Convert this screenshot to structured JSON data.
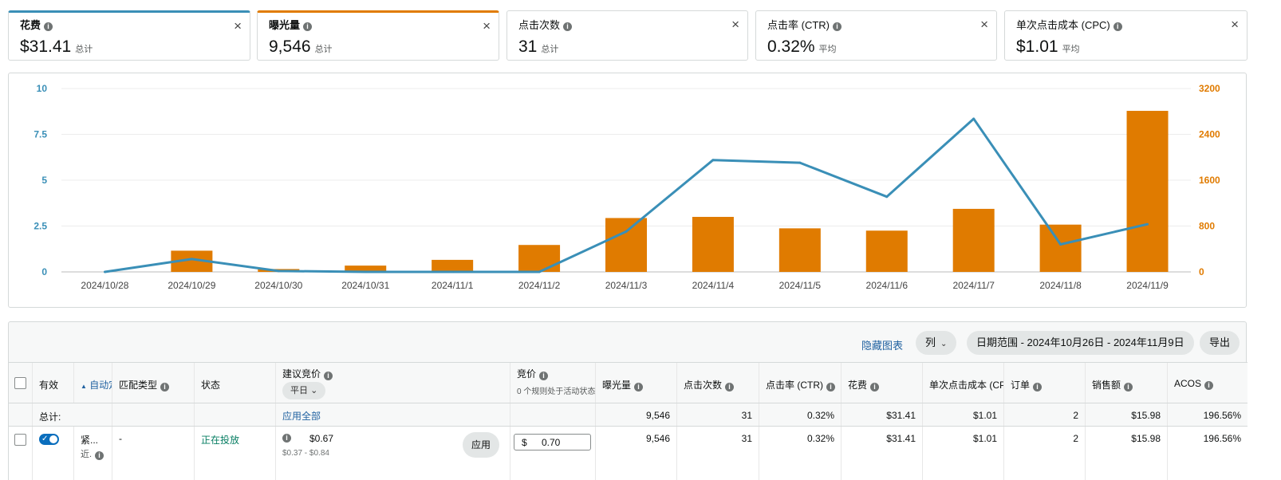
{
  "metric_cards": [
    {
      "label": "花费",
      "value": "$31.41",
      "suffix": "总计",
      "active": "blue"
    },
    {
      "label": "曝光量",
      "value": "9,546",
      "suffix": "总计",
      "active": "orange"
    },
    {
      "label": "点击次数",
      "value": "31",
      "suffix": "总计",
      "active": ""
    },
    {
      "label": "点击率 (CTR)",
      "value": "0.32%",
      "suffix": "平均",
      "active": ""
    },
    {
      "label": "单次点击成本 (CPC)",
      "value": "$1.01",
      "suffix": "平均",
      "active": ""
    }
  ],
  "icons": {
    "close": "close-icon",
    "info": "info-icon",
    "chevron": "chevron-down-icon",
    "check": "check-icon"
  },
  "colors": {
    "spend_line": "#3a8fb7",
    "impressions_bar": "#e07b00",
    "link": "#2162a1",
    "toggle_on": "#0a6ebd",
    "status_green": "#067d62"
  },
  "chart_data": {
    "type": "bar+line",
    "categories": [
      "2024/10/28",
      "2024/10/29",
      "2024/10/30",
      "2024/10/31",
      "2024/11/1",
      "2024/11/2",
      "2024/11/3",
      "2024/11/4",
      "2024/11/5",
      "2024/11/6",
      "2024/11/7",
      "2024/11/8",
      "2024/11/9"
    ],
    "series": [
      {
        "name": "曝光量",
        "type": "bar",
        "axis": "right",
        "color": "#e07b00",
        "values": [
          0,
          370,
          50,
          110,
          210,
          470,
          940,
          960,
          760,
          720,
          1100,
          825,
          2810
        ]
      },
      {
        "name": "花费",
        "type": "line",
        "axis": "left",
        "color": "#3a8fb7",
        "values": [
          0,
          0.7,
          0.05,
          0,
          0,
          0,
          2.2,
          6.1,
          5.95,
          4.1,
          8.35,
          1.5,
          2.6
        ]
      }
    ],
    "y_left": {
      "ticks": [
        "0",
        "2.5",
        "5",
        "7.5",
        "10"
      ],
      "range": [
        0,
        10
      ],
      "color": "#3a8fb7"
    },
    "y_right": {
      "ticks": [
        "0",
        "800",
        "1600",
        "2400",
        "3200"
      ],
      "range": [
        0,
        3200
      ],
      "color": "#e07b00"
    },
    "grid": true
  },
  "toolbar": {
    "hide_chart": "隐藏图表",
    "columns": "列",
    "date_range": "日期范围 - 2024年10月26日 - 2024年11月9日",
    "export": "导出"
  },
  "table": {
    "headers": {
      "active": "有效",
      "keyword": "自动定",
      "match_type": "匹配类型",
      "status": "状态",
      "suggested_bid": "建议竞价",
      "weekday": "平日",
      "bid": "竞价",
      "bid_rules": "0 个规则处于活动状态",
      "impressions": "曝光量",
      "clicks": "点击次数",
      "ctr": "点击率 (CTR)",
      "spend": "花费",
      "cpc": "单次点击成本 (CPC)",
      "orders": "订单",
      "sales": "销售额",
      "acos": "ACOS"
    },
    "totals": {
      "label": "总计:",
      "apply_all": "应用全部",
      "impressions": "9,546",
      "clicks": "31",
      "ctr": "0.32%",
      "spend": "$31.41",
      "cpc": "$1.01",
      "orders": "2",
      "sales": "$15.98",
      "acos": "196.56%"
    },
    "rows": [
      {
        "keyword": "紧...",
        "keyword_sub": "近.",
        "match_type": "-",
        "status": "正在投放",
        "suggested_bid": "$0.67",
        "suggested_range": "$0.37 - $0.84",
        "apply": "应用",
        "currency": "$",
        "bid": "0.70",
        "impressions": "9,546",
        "clicks": "31",
        "ctr": "0.32%",
        "spend": "$31.41",
        "cpc": "$1.01",
        "orders": "2",
        "sales": "$15.98",
        "acos": "196.56%"
      }
    ]
  }
}
